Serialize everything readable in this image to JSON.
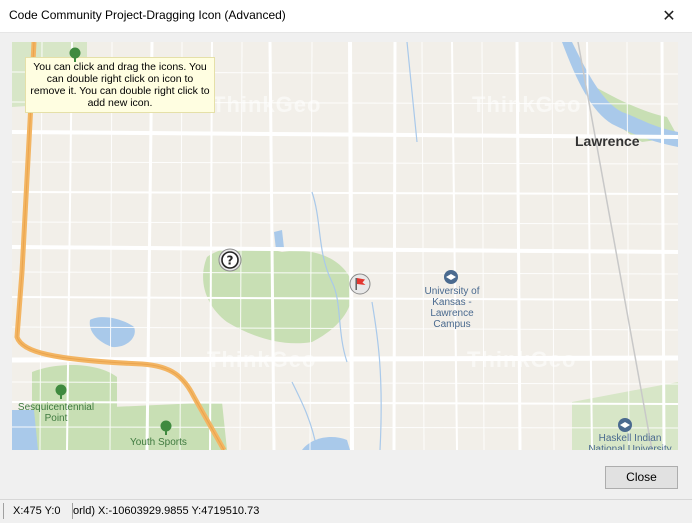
{
  "window": {
    "title": "Code Community Project-Dragging Icon (Advanced)",
    "close_glyph": "✕"
  },
  "map": {
    "tooltip": "You can click and drag the icons. You can double right click on icon to remove it. You can double right click to add new icon.",
    "watermark": "ThinkGeo",
    "labels": {
      "city": "Lawrence",
      "university": "University of Kansas - Lawrence Campus",
      "park1": "Sesquicentennial Point",
      "park2": "Youth Sports",
      "haskell": "Haskell Indian National University"
    },
    "icons": [
      "question-marker-icon",
      "red-flag-marker-icon",
      "university-icon",
      "tree-icon"
    ],
    "colors": {
      "background": "#f2efe9",
      "park": "#c8dfb4",
      "water": "#a9c9ea",
      "highway": "#f3b563",
      "road": "#ffffff"
    }
  },
  "buttons": {
    "close": "Close"
  },
  "status": {
    "screen_coords": "X:475 Y:0",
    "world_coords": "orld) X:-10603929.9855 Y:4719510.73"
  }
}
